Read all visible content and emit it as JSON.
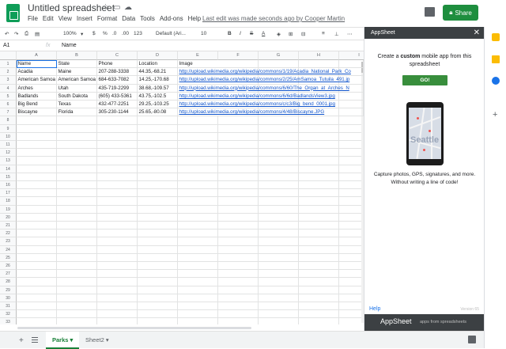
{
  "app": {
    "title": "Untitled spreadsheet",
    "menu": [
      "File",
      "Edit",
      "View",
      "Insert",
      "Format",
      "Data",
      "Tools",
      "Add-ons",
      "Help"
    ],
    "last_edit": "Last edit was made seconds ago by Cooper Martin",
    "share_label": "Share",
    "colors": {
      "brand": "#0f9d58",
      "share": "#1e8e3e",
      "link": "#1155cc"
    }
  },
  "toolbar": {
    "zoom": "100%",
    "currency": "$",
    "percent": "%",
    "dec_decrease": ".0",
    "dec_increase": ".00",
    "format_more": "123",
    "font": "Default (Ari...",
    "font_size": "10",
    "bold": "B",
    "italic": "I",
    "strike": "S",
    "text_color": "A"
  },
  "formula_bar": {
    "cell_ref": "A1",
    "fx": "fx",
    "value": "Name"
  },
  "grid": {
    "columns": [
      "A",
      "B",
      "C",
      "D",
      "E",
      "F",
      "G",
      "H",
      "I"
    ],
    "rows": [
      "1",
      "2",
      "3",
      "4",
      "5",
      "6",
      "7",
      "8",
      "9",
      "10",
      "11",
      "12",
      "13",
      "14",
      "15",
      "16",
      "17",
      "18",
      "19",
      "20",
      "21",
      "22",
      "23",
      "24",
      "25",
      "26",
      "27",
      "28",
      "29",
      "30",
      "31",
      "32",
      "33"
    ],
    "cells": [
      [
        "Name",
        "State",
        "Phone",
        "Location",
        "Image"
      ],
      [
        "Acadia",
        "Maine",
        "207-288-3338",
        "44.35,-68.21",
        "http://upload.wikimedia.org/wikipedia/commons/1/19/Acadia_National_Park_Co"
      ],
      [
        "American Samoa",
        "American Samoa",
        "684-633-7082",
        "14.25,-170.68",
        "http://upload.wikimedia.org/wikipedia/commons/2/25/AmSamoa_Tutuila_491.jp"
      ],
      [
        "Arches",
        "Utah",
        "435-719-2299",
        "38.68,-109.57",
        "http://upload.wikimedia.org/wikipedia/commons/6/60/The_Organ_at_Arches_N"
      ],
      [
        "Badlands",
        "South Dakota",
        "(605) 433-5361",
        "43.75,-102.5",
        "http://upload.wikimedia.org/wikipedia/commons/6/6d/BadlandsView3.jpg"
      ],
      [
        "Big Bend",
        "Texas",
        "432-477-2251",
        "29.25,-103.25",
        "http://upload.wikimedia.org/wikipedia/commons/c/c3/Big_bend_0001.jpg"
      ],
      [
        "Biscayne",
        "Florida",
        "305-230-1144",
        "25.65,-80.08",
        "http://upload.wikimedia.org/wikipedia/commons/4/48/Biscayne.JPG"
      ]
    ]
  },
  "sheets": [
    {
      "label": "Parks",
      "active": true
    },
    {
      "label": "Sheet2",
      "active": false
    }
  ],
  "sidebar": {
    "title": "AppSheet",
    "intro_prefix": "Create a ",
    "intro_bold": "custom",
    "intro_suffix": " mobile app from this spreadsheet",
    "go_label": "GO!",
    "phone_city": "Seattle",
    "caption": "Capture photos, GPS, signatures, and more. Without writing a line of code!",
    "help": "Help",
    "version": "Version 65",
    "footer_brand": "AppSheet",
    "footer_tagline": "apps from spreadsheets"
  }
}
